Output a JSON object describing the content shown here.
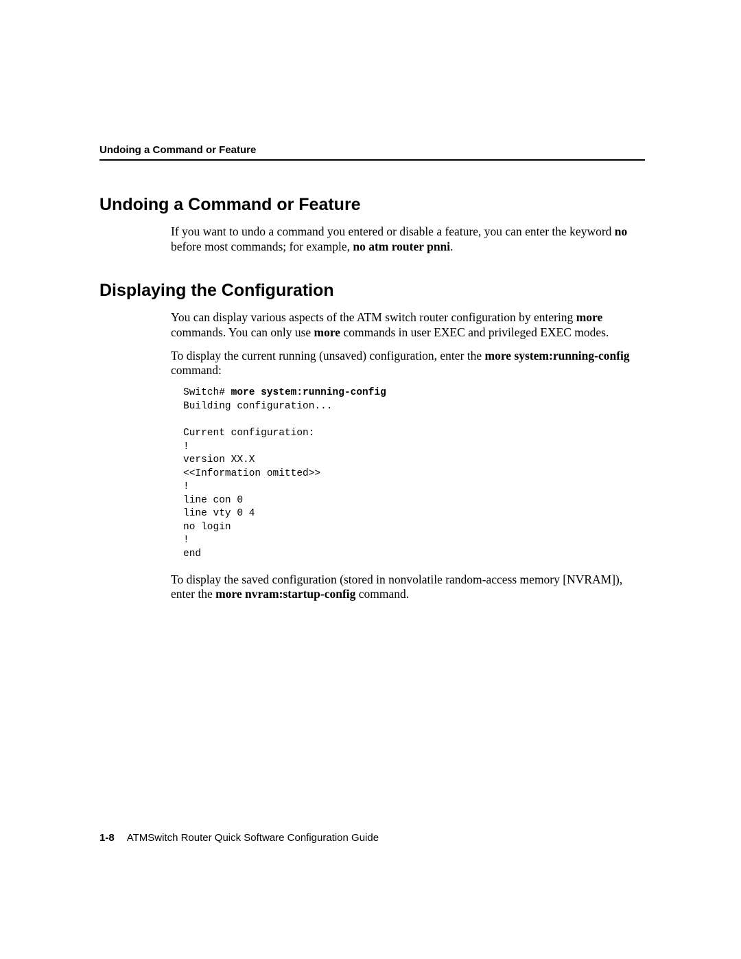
{
  "header": {
    "running_title": "Undoing a Command or Feature"
  },
  "section1": {
    "heading": "Undoing a Command or Feature",
    "p1_a": "If you want to undo a command you entered or disable a feature, you can enter the keyword ",
    "p1_b": "no",
    "p1_c": " before most commands; for example, ",
    "p1_d": "no atm router pnni",
    "p1_e": "."
  },
  "section2": {
    "heading": "Displaying the Configuration",
    "p1_a": "You can display various aspects of the ATM switch router configuration by entering ",
    "p1_b": "more",
    "p1_c": " commands. You can only use ",
    "p1_d": "more",
    "p1_e": " commands in user EXEC and privileged EXEC modes.",
    "p2_a": "To display the current running (unsaved) configuration, enter the ",
    "p2_b": "more system:running-config",
    "p2_c": " command:",
    "code_prompt": "Switch# ",
    "code_cmd": "more system:running-config",
    "code_body": "Building configuration...\n\nCurrent configuration:\n!\nversion XX.X\n<<Information omitted>>\n!\nline con 0\nline vty 0 4\nno login\n!\nend",
    "p3_a": "To display the saved configuration (stored in nonvolatile random-access memory [NVRAM]), enter the ",
    "p3_b": "more nvram:startup-config",
    "p3_c": " command."
  },
  "footer": {
    "page_number": "1-8",
    "doc_title": "ATMSwitch Router Quick Software Configuration Guide"
  }
}
